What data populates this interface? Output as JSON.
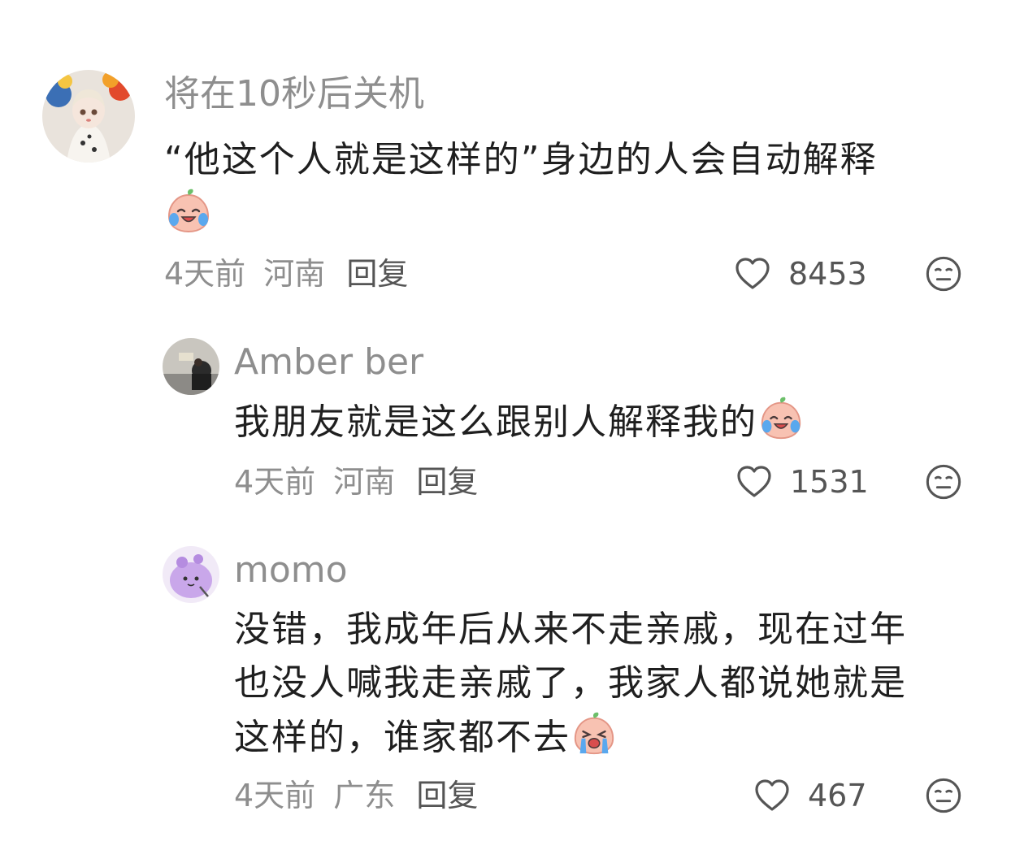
{
  "comments": [
    {
      "username": "将在10秒后关机",
      "text": "“他这个人就是这样的”身边的人会自动解释",
      "time": "4天前",
      "location": "河南",
      "reply_label": "回复",
      "likes": "8453",
      "emoji": "laughing-crying-peach"
    },
    {
      "username": "Amber ber",
      "text": "我朋友就是这么跟别人解释我的",
      "time": "4天前",
      "location": "河南",
      "reply_label": "回复",
      "likes": "1531",
      "emoji": "laughing-crying-peach"
    },
    {
      "username": "momo",
      "text_line1": "没错，我成年后从来不走亲戚，现在过年",
      "text_line2": "也没人喊我走亲戚了，我家人都说她就是",
      "text_line3": "这样的，谁家都不去",
      "time": "4天前",
      "location": "广东",
      "reply_label": "回复",
      "likes": "467",
      "emoji": "crying-peach"
    }
  ],
  "colors": {
    "meta_gray": "#8e8e8e",
    "text": "#1f1f1f",
    "icon_gray": "#666666",
    "peach": "#f6b5a4"
  }
}
